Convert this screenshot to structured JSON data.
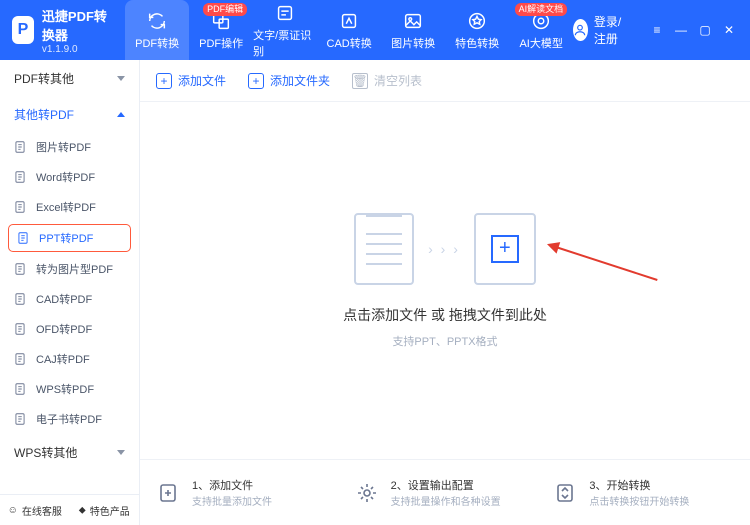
{
  "brand": {
    "name": "迅捷PDF转换器",
    "version": "v1.1.9.0"
  },
  "topnav": [
    {
      "label": "PDF转换"
    },
    {
      "label": "PDF操作",
      "badge": "PDF编辑"
    },
    {
      "label": "文字/票证识别"
    },
    {
      "label": "CAD转换"
    },
    {
      "label": "图片转换"
    },
    {
      "label": "特色转换"
    },
    {
      "label": "AI大模型",
      "badge": "AI解读文档"
    }
  ],
  "login_label": "登录/注册",
  "sidebar": {
    "groups": [
      {
        "label": "PDF转其他",
        "open": false
      },
      {
        "label": "其他转PDF",
        "open": true
      },
      {
        "label": "WPS转其他",
        "open": false
      }
    ],
    "items": [
      "图片转PDF",
      "Word转PDF",
      "Excel转PDF",
      "PPT转PDF",
      "转为图片型PDF",
      "CAD转PDF",
      "OFD转PDF",
      "CAJ转PDF",
      "WPS转PDF",
      "电子书转PDF"
    ],
    "selected_index": 3,
    "footer": {
      "left": "在线客服",
      "right": "特色产品"
    }
  },
  "toolbar": {
    "add_file": "添加文件",
    "add_folder": "添加文件夹",
    "clear_list": "清空列表"
  },
  "drop": {
    "title": "点击添加文件 或 拖拽文件到此处",
    "subtitle": "支持PPT、PPTX格式"
  },
  "steps": [
    {
      "title": "1、添加文件",
      "sub": "支持批量添加文件"
    },
    {
      "title": "2、设置输出配置",
      "sub": "支持批量操作和各种设置"
    },
    {
      "title": "3、开始转换",
      "sub": "点击转换按钮开始转换"
    }
  ]
}
